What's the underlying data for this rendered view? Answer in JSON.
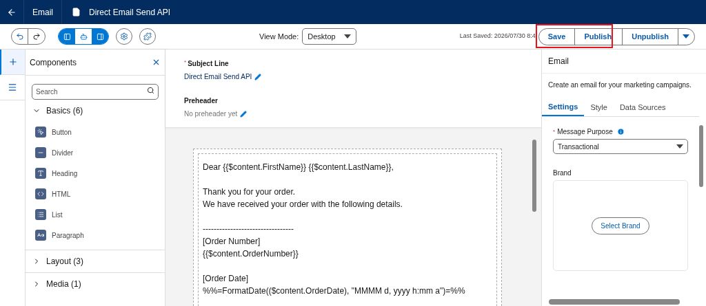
{
  "header": {
    "section": "Email",
    "title": "Direct Email Send API"
  },
  "toolbar": {
    "panel_toggles": [
      {
        "selected": true
      },
      {
        "selected": false
      },
      {
        "selected": true
      }
    ],
    "view_mode_label": "View Mode:",
    "view_mode": "Desktop",
    "last_saved": "Last Saved: 2026/07/30 8:4",
    "actions": [
      "Save",
      "Publish",
      "Unpublish"
    ],
    "highlighted": true
  },
  "rail": [
    {
      "selected": true
    },
    {
      "selected": false
    }
  ],
  "components": {
    "title": "Components",
    "search_placeholder": "Search",
    "groups": [
      {
        "label": "Basics (6)",
        "expanded": true,
        "items": [
          "Button",
          "Divider",
          "Heading",
          "HTML",
          "List",
          "Paragraph"
        ]
      },
      {
        "label": "Layout (3)",
        "expanded": false
      },
      {
        "label": "Media (1)",
        "expanded": false
      }
    ]
  },
  "email": {
    "subject_required_mark": "*",
    "subject_label": "Subject Line",
    "subject": "Direct Email Send API",
    "preheader_label": "Preheader",
    "preheader": "No preheader yet",
    "body": [
      [
        "Dear {{$content.FirstName}} {{$content.LastName}},"
      ],
      [
        "Thank you for your order.",
        "We have received your order with the following details."
      ],
      [
        "---------------------------------",
        "[Order Number]",
        "{{$content.OrderNumber}}"
      ],
      [
        "[Order Date]",
        "%%=FormatDate(($content.OrderDate), \"MMMM d, yyyy h:mm a\")=%%"
      ]
    ]
  },
  "properties": {
    "title": "Email",
    "description": "Create an email for your marketing campaigns.",
    "tabs": [
      {
        "label": "Settings",
        "selected": true
      },
      {
        "label": "Style",
        "selected": false
      },
      {
        "label": "Data Sources",
        "selected": false
      }
    ],
    "purpose_required_mark": "*",
    "purpose_label": "Message Purpose",
    "purpose": "Transactional",
    "brand_label": "Brand",
    "brand_button": "Select Brand"
  }
}
